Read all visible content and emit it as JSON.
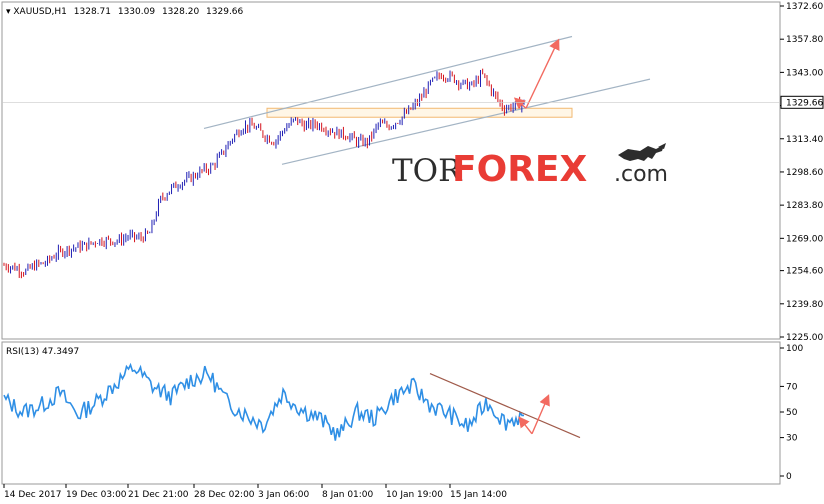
{
  "watermark": {
    "prefix": "TOR",
    "brand": "FOREX",
    "suffix": ".com"
  },
  "colors": {
    "bull": "#1f1fb4",
    "bear": "#d4111a",
    "rsi_line": "#2f8fe5",
    "channel": "#a3b4c4",
    "rsi_trend": "#a05a4a",
    "arrow": "#f26a60",
    "zone_border": "#f2b870",
    "zone_fill": "#fff6e6",
    "watermark_dark": "#222222",
    "watermark_brand": "#e8322b",
    "price_marker_bg": "#ffffff"
  },
  "chart_data": [
    {
      "type": "candlestick",
      "title": "XAUUSD,H1",
      "ohlc_header": [
        "1328.71",
        "1330.09",
        "1328.20",
        "1329.66"
      ],
      "ylim": [
        1225.0,
        1372.6
      ],
      "y_ticks": [
        "1372.60",
        "1357.80",
        "1343.00",
        "1328.20",
        "1313.40",
        "1298.60",
        "1283.80",
        "1269.00",
        "1254.60",
        "1239.80",
        "1225.00"
      ],
      "current_price": "1329.66",
      "x_labels": [
        "14 Dec 2017",
        "19 Dec 03:00",
        "21 Dec 21:00",
        "28 Dec 02:00",
        "3 Jan 06:00",
        "8 Jan 01:00",
        "10 Jan 19:00",
        "15 Jan 14:00"
      ],
      "path_points": [
        [
          0,
          1257
        ],
        [
          0.02,
          1256
        ],
        [
          0.04,
          1254
        ],
        [
          0.06,
          1257
        ],
        [
          0.08,
          1258
        ],
        [
          0.1,
          1262
        ],
        [
          0.12,
          1264
        ],
        [
          0.14,
          1265
        ],
        [
          0.16,
          1266
        ],
        [
          0.18,
          1268
        ],
        [
          0.2,
          1268
        ],
        [
          0.22,
          1268
        ],
        [
          0.24,
          1270
        ],
        [
          0.26,
          1269
        ],
        [
          0.28,
          1271
        ],
        [
          0.3,
          1286
        ],
        [
          0.32,
          1291
        ],
        [
          0.34,
          1294
        ],
        [
          0.36,
          1296
        ],
        [
          0.38,
          1299
        ],
        [
          0.4,
          1301
        ],
        [
          0.42,
          1307
        ],
        [
          0.44,
          1314
        ],
        [
          0.46,
          1319
        ],
        [
          0.48,
          1319
        ],
        [
          0.5,
          1315
        ],
        [
          0.52,
          1312
        ],
        [
          0.54,
          1318
        ],
        [
          0.56,
          1322
        ],
        [
          0.58,
          1319
        ],
        [
          0.6,
          1320
        ],
        [
          0.62,
          1318
        ],
        [
          0.64,
          1316
        ],
        [
          0.66,
          1315
        ],
        [
          0.68,
          1312
        ],
        [
          0.7,
          1312
        ],
        [
          0.72,
          1320
        ],
        [
          0.74,
          1319
        ],
        [
          0.76,
          1322
        ],
        [
          0.78,
          1326
        ],
        [
          0.8,
          1331
        ],
        [
          0.82,
          1338
        ],
        [
          0.84,
          1342
        ],
        [
          0.86,
          1341
        ],
        [
          0.88,
          1338
        ],
        [
          0.9,
          1337
        ],
        [
          0.92,
          1342
        ],
        [
          0.94,
          1334
        ],
        [
          0.96,
          1327
        ],
        [
          0.98,
          1328
        ],
        [
          1.0,
          1329.66
        ]
      ],
      "trend_channel": [
        {
          "from": [
            0.0,
            1318
          ],
          "to": [
            1.0,
            1359
          ]
        },
        {
          "from": [
            0.0,
            1302
          ],
          "to": [
            1.0,
            1340
          ]
        }
      ],
      "support_zone": [
        1327,
        1323
      ],
      "forecast_arrows": [
        {
          "from": [
            0.97,
            1327
          ],
          "to": [
            0.93,
            1331
          ]
        },
        {
          "from": [
            0.97,
            1328
          ],
          "to": [
            1.05,
            1356
          ]
        }
      ]
    },
    {
      "type": "line",
      "title": "RSI(13) 47.3497",
      "ylim": [
        0,
        100
      ],
      "y_ticks": [
        "100",
        "70",
        "50",
        "30",
        "0"
      ],
      "path_points": [
        [
          0,
          60
        ],
        [
          0.05,
          50
        ],
        [
          0.1,
          55
        ],
        [
          0.15,
          65
        ],
        [
          0.2,
          48
        ],
        [
          0.25,
          58
        ],
        [
          0.3,
          72
        ],
        [
          0.35,
          85
        ],
        [
          0.4,
          70
        ],
        [
          0.45,
          62
        ],
        [
          0.5,
          75
        ],
        [
          0.55,
          80
        ],
        [
          0.6,
          58
        ],
        [
          0.65,
          48
        ],
        [
          0.7,
          40
        ],
        [
          0.75,
          65
        ],
        [
          0.8,
          52
        ],
        [
          0.85,
          45
        ],
        [
          0.9,
          32
        ],
        [
          0.95,
          50
        ],
        [
          1.0,
          45
        ],
        [
          1.05,
          62
        ],
        [
          1.1,
          70
        ],
        [
          1.15,
          55
        ],
        [
          1.2,
          48
        ],
        [
          1.25,
          38
        ],
        [
          1.3,
          58
        ],
        [
          1.35,
          42
        ],
        [
          1.4,
          47.3497
        ]
      ],
      "trend_line": {
        "from": [
          0.0,
          80
        ],
        "to": [
          1.0,
          30
        ]
      },
      "forecast_arrows": [
        {
          "from": [
            0.95,
            33
          ],
          "to": [
            0.9,
            45
          ]
        },
        {
          "from": [
            0.95,
            33
          ],
          "to": [
            1.05,
            62
          ]
        }
      ]
    }
  ]
}
